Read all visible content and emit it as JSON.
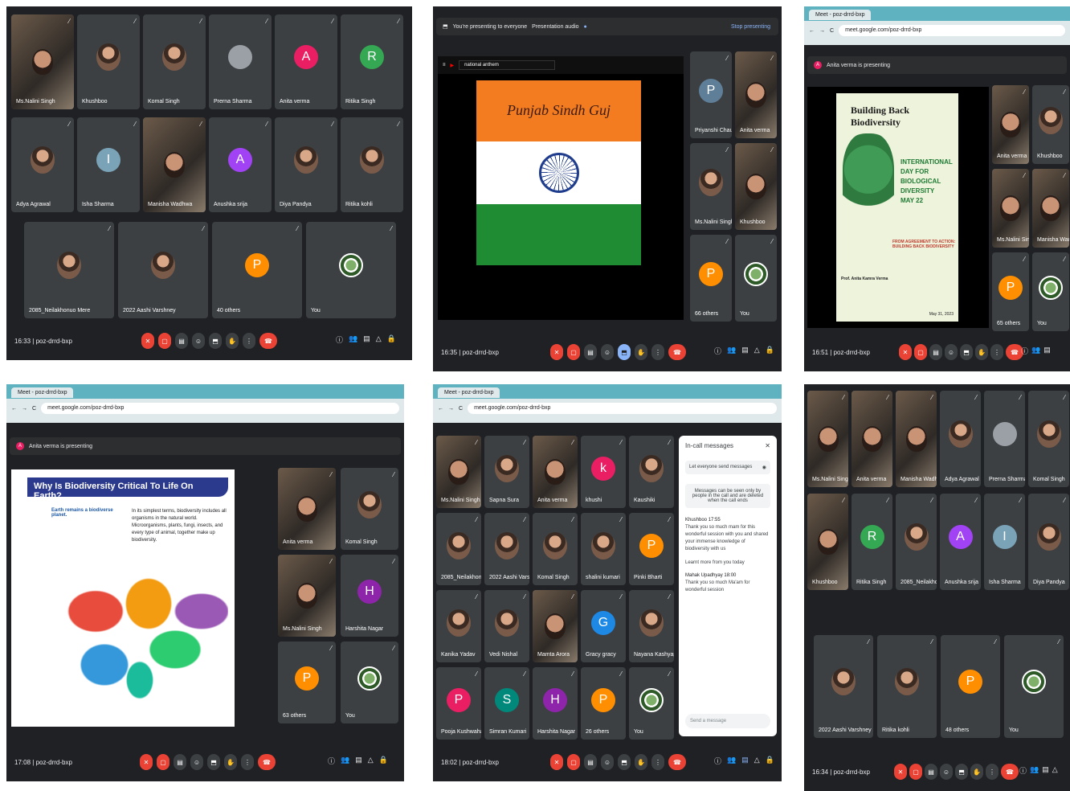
{
  "panels": {
    "p1": {
      "participants": [
        {
          "name": "Ms.Nalini Singh",
          "kind": "video"
        },
        {
          "name": "Khushboo",
          "kind": "photo"
        },
        {
          "name": "Komal Singh",
          "kind": "photo"
        },
        {
          "name": "Prerna Sharma",
          "kind": "avatar",
          "letter": "",
          "color": "#9aa0a6"
        },
        {
          "name": "Anita verma",
          "kind": "avatar",
          "letter": "A",
          "color": "#e91e63"
        },
        {
          "name": "Ritika Singh",
          "kind": "avatar",
          "letter": "R",
          "color": "#34a853"
        },
        {
          "name": "Adya Agrawal",
          "kind": "photo"
        },
        {
          "name": "Isha Sharma",
          "kind": "avatar",
          "letter": "I",
          "color": "#7aa3b8"
        },
        {
          "name": "Manisha Wadhwa",
          "kind": "video"
        },
        {
          "name": "Anushka srija",
          "kind": "avatar",
          "letter": "A",
          "color": "#a142f4"
        },
        {
          "name": "Diya Pandya",
          "kind": "photo"
        },
        {
          "name": "Ritika kohli",
          "kind": "photo"
        },
        {
          "name": "2085_Neilakhonuo Mere",
          "kind": "photo"
        },
        {
          "name": "2022 Aashi Varshney",
          "kind": "photo"
        },
        {
          "name": "40 others",
          "kind": "others"
        },
        {
          "name": "You",
          "kind": "logo"
        }
      ],
      "time": "16:33",
      "code": "poz-drrd-bxp",
      "count": "56"
    },
    "p2": {
      "banner": "You're presenting to everyone",
      "audio": "Presentation audio",
      "stop": "Stop presenting",
      "search": "national anthem",
      "flag_text": "Punjab Sindh Guj",
      "participants": [
        "Priyanshi Chauh...",
        "Anita verma",
        "Ms.Nalini Singh",
        "Khushboo",
        "66 others",
        "You"
      ],
      "time": "16:35",
      "code": "poz-drrd-bxp",
      "count": "74"
    },
    "p3": {
      "tab": "Meet - poz-drrd-bxp",
      "url": "meet.google.com/poz-drrd-bxp",
      "presenting": "Anita verma is presenting",
      "slide_title": "Building Back Biodiversity",
      "slide_lines": [
        "INTERNATIONAL",
        "DAY FOR BIOLOGICAL",
        "DIVERSITY",
        "MAY 22"
      ],
      "slide_sub": "FROM AGREEMENT TO ACTION: BUILDING BACK BIODIVERSITY",
      "author": "Prof. Anita Kamra Verma",
      "date": "May 31, 2023",
      "participants": [
        "Anita verma",
        "Khushboo",
        "Ms.Nalini Singh",
        "Manisha Wadhwa",
        "65 others",
        "You"
      ],
      "time": "16:51",
      "code": "poz-drrd-bxp",
      "count": "72"
    },
    "p4": {
      "tab": "Meet - poz-drrd-bxp",
      "url": "meet.google.com/poz-drrd-bxp",
      "presenting": "Anita verma is presenting",
      "slide_title": "Why Is Biodiversity Critical To Life On Earth?",
      "left_text": "Earth remains a biodiverse planet.",
      "body": "In its simplest terms, biodiversity includes all organisms in the natural world. Microorganisms, plants, fungi, insects, and every type of animal, together make up biodiversity.",
      "participants": [
        "Anita verma",
        "Komal Singh",
        "Ms.Nalini Singh",
        "Harshita Nagar",
        "63 others",
        "You"
      ],
      "time": "17:08",
      "code": "poz-drrd-bxp",
      "count": "70"
    },
    "p5": {
      "tab": "Meet - poz-drrd-bxp",
      "url": "meet.google.com/poz-drrd-bxp",
      "participants": [
        "Ms.Nalini Singh",
        "Sapna Sura",
        "Anita verma",
        "khushi",
        "Kaushiki",
        "2085_Neilakhonu...",
        "2022 Aashi Varshn...",
        "Komal Singh",
        "shalini kumari",
        "Pinki Bharti",
        "Kanika Yadav",
        "Vedi Nishal",
        "Mamta Arora",
        "Gracy gracy",
        "Nayana Kashyap",
        "Pooja Kushwaha",
        "Simran Kumari",
        "Harshita Nagar",
        "26 others",
        "You"
      ],
      "chat": {
        "title": "In-call messages",
        "toggle": "Let everyone send messages",
        "notice": "Messages can be seen only by people in the call and are deleted when the call ends",
        "messages": [
          {
            "from": "Khushboo 17:55",
            "text": "Thank you so much mam for this wonderful session with you and shared your immense knowledge of biodiversity with us"
          },
          {
            "from": "",
            "text": "Learnt more from you today"
          },
          {
            "from": "Mahak Upadhyay 18:00",
            "text": "Thank you so much Ma'am for wonderful session"
          }
        ],
        "placeholder": "Send a message"
      },
      "time": "18:02",
      "code": "poz-drrd-bxp",
      "count": "46"
    },
    "p6": {
      "participants": [
        "Ms.Nalini Singh",
        "Anita verma",
        "Manisha Wadhwa",
        "Adya Agrawal",
        "Prerna Sharma",
        "Komal Singh",
        "Khushboo",
        "Ritika Singh",
        "2085_Neilakhonuo Mere",
        "Anushka srija",
        "Isha Sharma",
        "Diya Pandya",
        "2022 Aashi Varshney",
        "Ritika kohli",
        "48 others",
        "You"
      ],
      "time": "16:34",
      "code": "poz-drrd-bxp",
      "count": "62"
    }
  },
  "colors": {
    "meet_bg": "#202124",
    "tile": "#3c4043",
    "end": "#ea4335"
  }
}
